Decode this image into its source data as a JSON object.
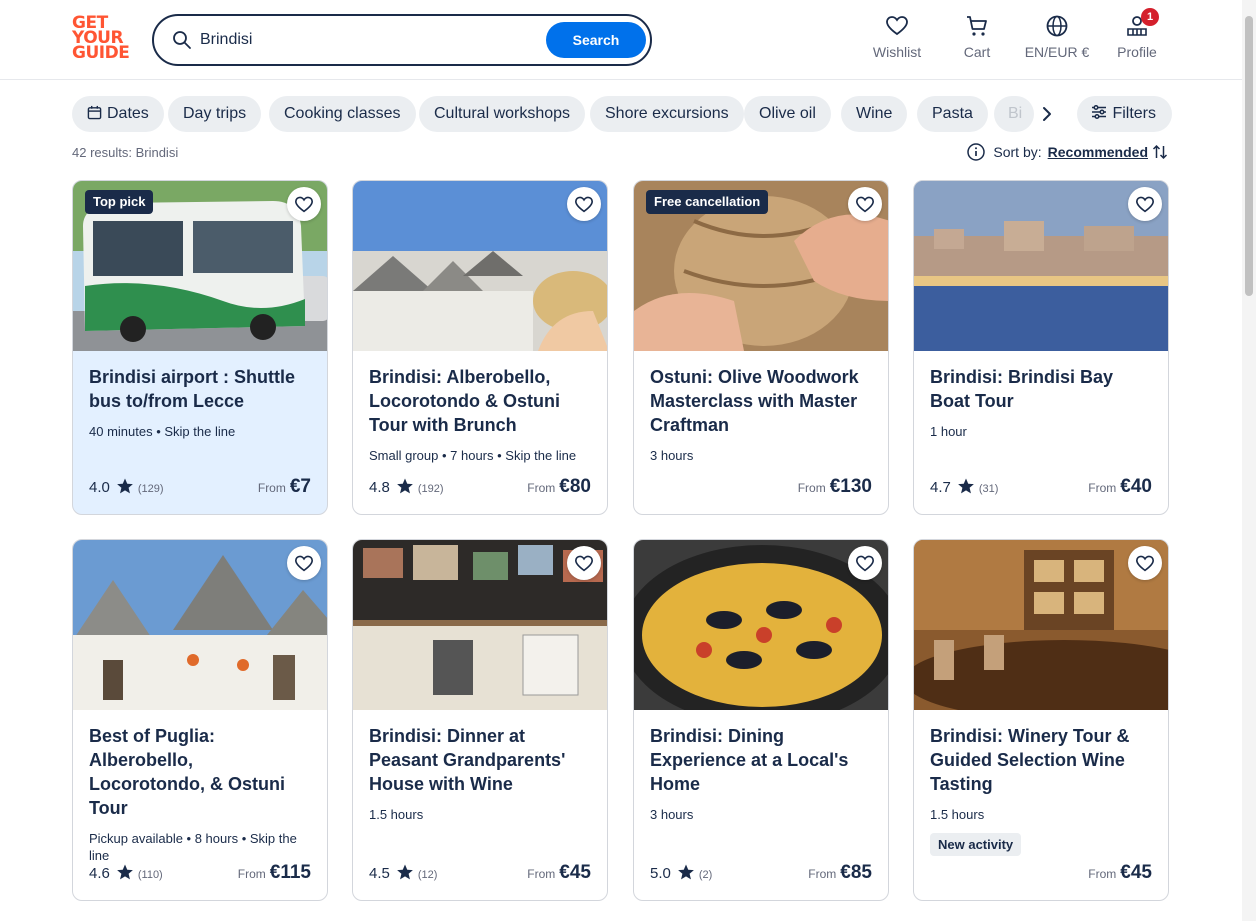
{
  "header": {
    "logo_lines": [
      "GET",
      "YOUR",
      "GUIDE"
    ],
    "search_value": "Brindisi",
    "search_button": "Search",
    "nav": [
      {
        "label": "Wishlist",
        "icon": "heart-icon"
      },
      {
        "label": "Cart",
        "icon": "cart-icon"
      },
      {
        "label": "EN/EUR €",
        "icon": "globe-icon"
      },
      {
        "label": "Profile",
        "icon": "profile-icon",
        "badge": "1"
      }
    ]
  },
  "chips": {
    "dates": "Dates",
    "items": [
      "Day trips",
      "Cooking classes",
      "Cultural workshops",
      "Shore excursions",
      "Olive oil",
      "Wine",
      "Pasta"
    ],
    "faded": "Bi",
    "filters": "Filters"
  },
  "results": {
    "count_text": "42 results: Brindisi",
    "sort_label": "Sort by:",
    "sort_value": "Recommended"
  },
  "cards": [
    {
      "title": "Brindisi airport : Shuttle bus to/from Lecce",
      "meta": "40 minutes • Skip the line",
      "tag": "Top pick",
      "rating": "4.0",
      "reviews": "(129)",
      "from": "From",
      "price": "€7"
    },
    {
      "title": "Brindisi: Alberobello, Locorotondo & Ostuni Tour with Brunch",
      "meta": "Small group • 7 hours • Skip the line",
      "tag": "",
      "rating": "4.8",
      "reviews": "(192)",
      "from": "From",
      "price": "€80"
    },
    {
      "title": "Ostuni: Olive Woodwork Masterclass with Master Craftman",
      "meta": "3 hours",
      "tag": "Free cancellation",
      "rating": "",
      "reviews": "",
      "from": "From",
      "price": "€130"
    },
    {
      "title": "Brindisi: Brindisi Bay Boat Tour",
      "meta": "1 hour",
      "tag": "",
      "rating": "4.7",
      "reviews": "(31)",
      "from": "From",
      "price": "€40"
    },
    {
      "title": "Best of Puglia: Alberobello, Locorotondo, & Ostuni Tour",
      "meta": "Pickup available • 8 hours • Skip the line",
      "tag": "",
      "rating": "4.6",
      "reviews": "(110)",
      "from": "From",
      "price": "€115"
    },
    {
      "title": "Brindisi: Dinner at Peasant Grandparents' House with Wine",
      "meta": "1.5 hours",
      "tag": "",
      "rating": "4.5",
      "reviews": "(12)",
      "from": "From",
      "price": "€45"
    },
    {
      "title": "Brindisi: Dining Experience at a Local's Home",
      "meta": "3 hours",
      "tag": "",
      "rating": "5.0",
      "reviews": "(2)",
      "from": "From",
      "price": "€85"
    },
    {
      "title": "Brindisi: Winery Tour & Guided Selection Wine Tasting",
      "meta": "1.5 hours",
      "tag": "",
      "new_tag": "New activity",
      "rating": "",
      "reviews": "",
      "from": "From",
      "price": "€45"
    }
  ],
  "colors": {
    "brand": "#ff5533",
    "primary": "#0071eb",
    "text": "#1a2b49",
    "highlight_card": "#e3f0ff"
  }
}
